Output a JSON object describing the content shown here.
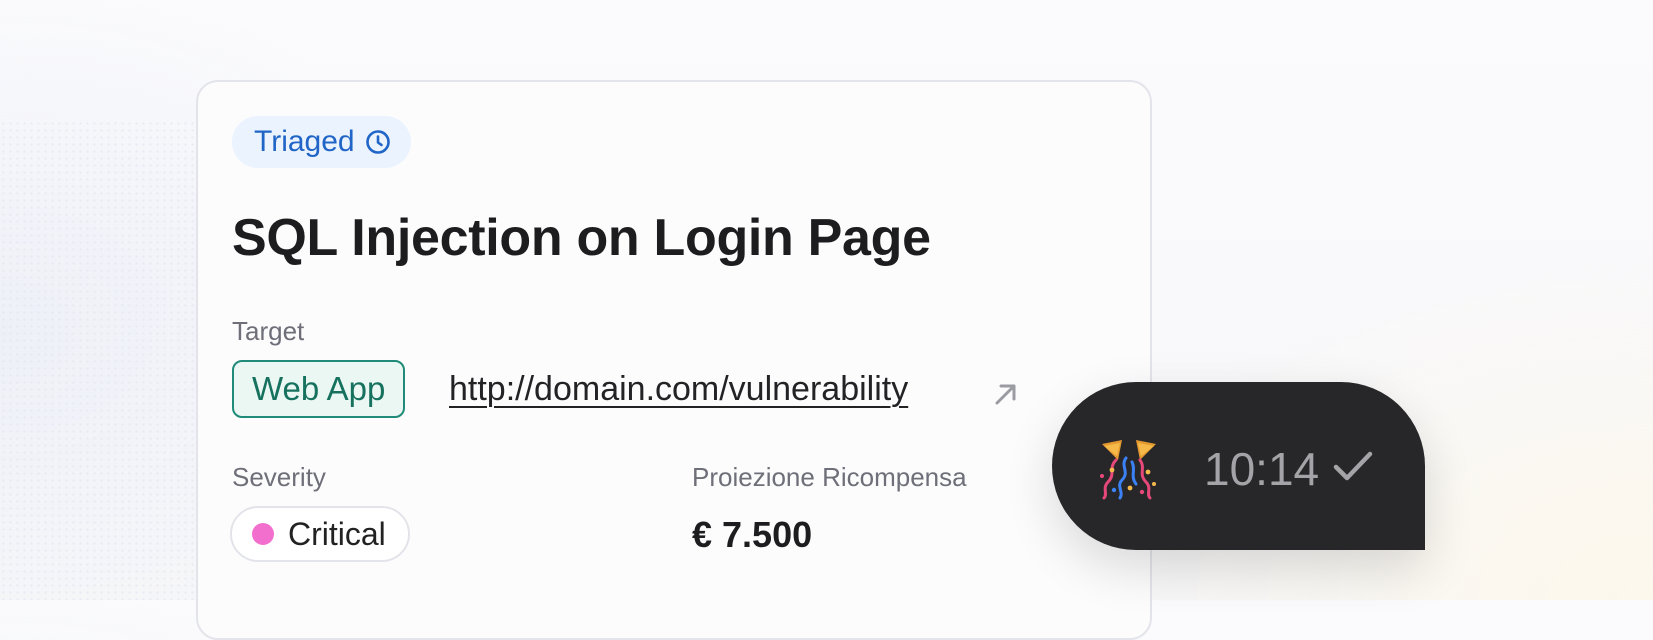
{
  "report": {
    "status": "Triaged",
    "title": "SQL Injection on Login Page",
    "target_label": "Target",
    "target_type": "Web App",
    "target_url": "http://domain.com/vulnerability",
    "severity_label": "Severity",
    "severity": "Critical",
    "reward_label": "Proiezione Ricompensa",
    "reward_value": "€ 7.500"
  },
  "message": {
    "emoji_icon": "party-popper-icon",
    "time": "10:14",
    "status_icon": "check-icon"
  },
  "colors": {
    "status_blue": "#2166c7",
    "target_teal": "#1f8b78",
    "severity_pink": "#f26fcd",
    "message_bg": "#27272a"
  }
}
